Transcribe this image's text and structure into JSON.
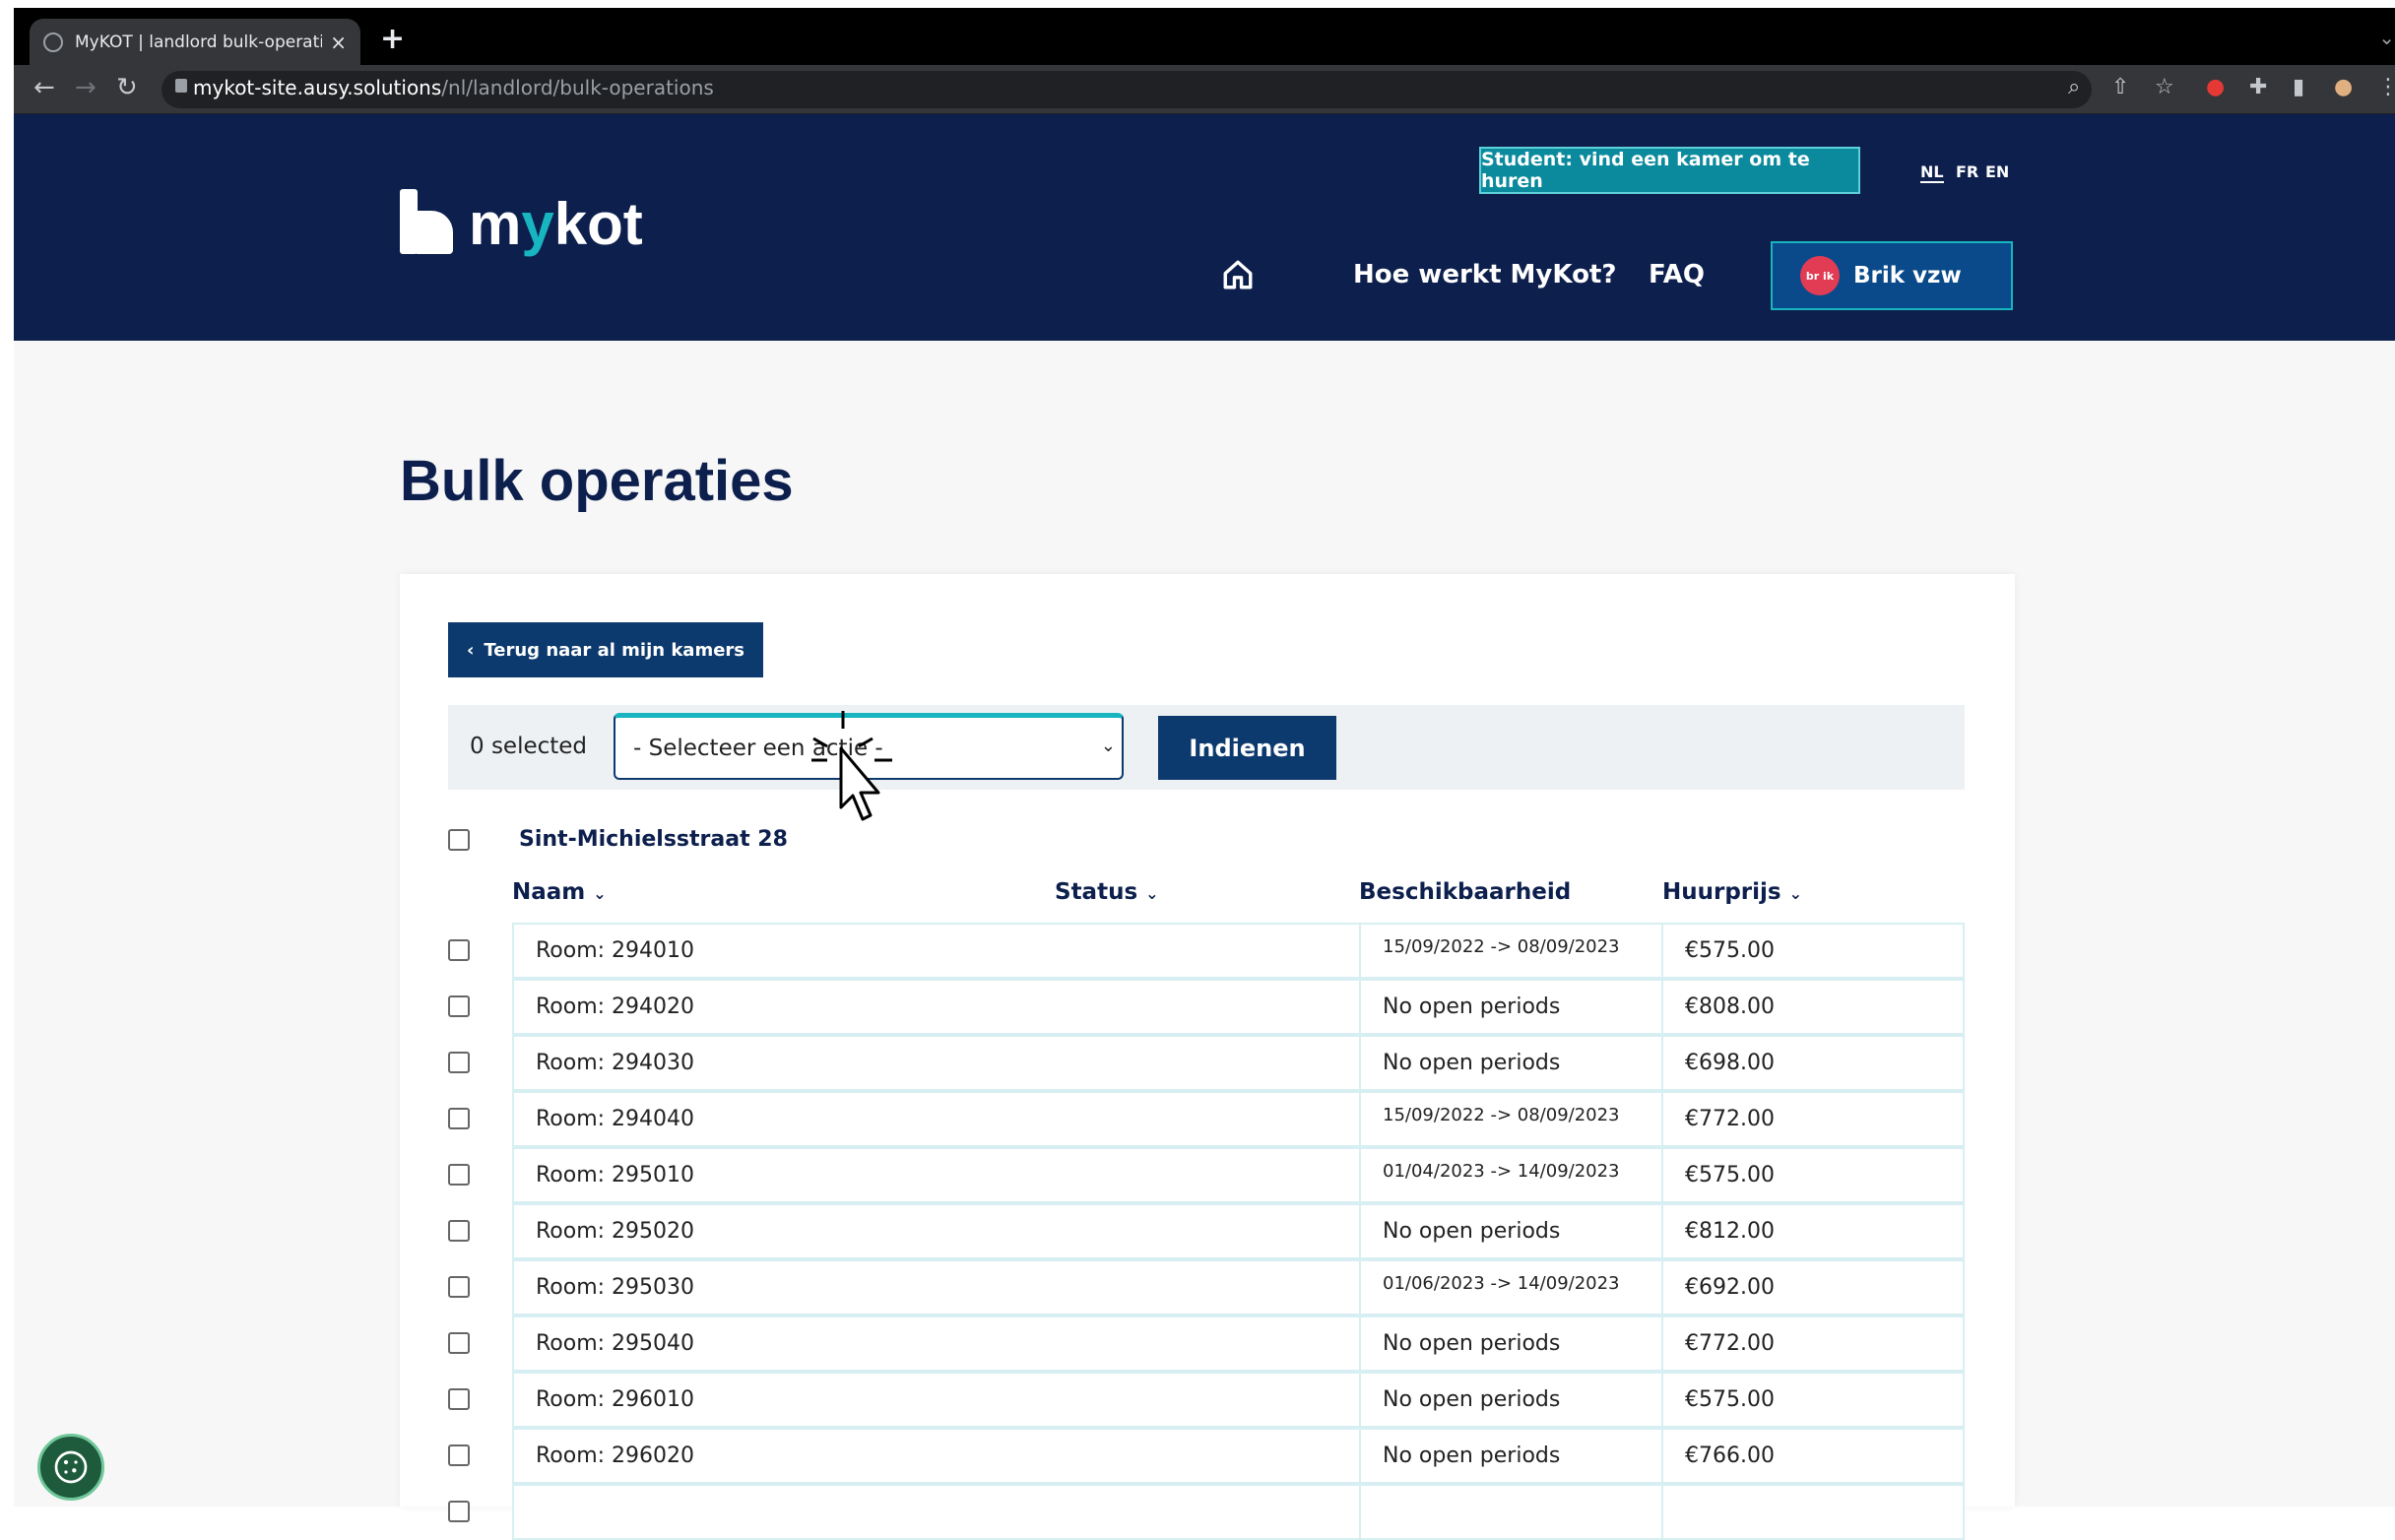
{
  "browser": {
    "tab_title": "MyKOT | landlord bulk-operatio",
    "tab_close": "×",
    "new_tab": "+",
    "url_host": "mykot-site.ausy.solutions",
    "url_path": "/nl/landlord/bulk-operations"
  },
  "header": {
    "logo_text_prefix": "m",
    "logo_text_y": "y",
    "logo_text_suffix": "kot",
    "student_button": "Student: vind een kamer om te huren",
    "languages": [
      "NL",
      "FR",
      "EN"
    ],
    "active_language": "NL",
    "nav": {
      "how_it_works": "Hoe werkt MyKot?",
      "faq": "FAQ"
    },
    "user": {
      "avatar_text": "br ik",
      "name": "Brik vzw"
    }
  },
  "page": {
    "title": "Bulk operaties",
    "back_button": "Terug naar al mijn kamers",
    "selected_count": "0 selected",
    "action_select_value": "- Selecteer een actie -",
    "submit_button": "Indienen",
    "group_title": "Sint-Michielsstraat 28",
    "columns": {
      "name": "Naam",
      "status": "Status",
      "availability": "Beschikbaarheid",
      "price": "Huurprijs"
    },
    "rooms": [
      {
        "name": "Room: 294010",
        "availability": "15/09/2022 -> 08/09/2023",
        "price": "€575.00"
      },
      {
        "name": "Room: 294020",
        "availability": "No open periods",
        "price": "€808.00"
      },
      {
        "name": "Room: 294030",
        "availability": "No open periods",
        "price": "€698.00"
      },
      {
        "name": "Room: 294040",
        "availability": "15/09/2022 -> 08/09/2023",
        "price": "€772.00"
      },
      {
        "name": "Room: 295010",
        "availability": "01/04/2023 -> 14/09/2023",
        "price": "€575.00"
      },
      {
        "name": "Room: 295020",
        "availability": "No open periods",
        "price": "€812.00"
      },
      {
        "name": "Room: 295030",
        "availability": "01/06/2023 -> 14/09/2023",
        "price": "€692.00"
      },
      {
        "name": "Room: 295040",
        "availability": "No open periods",
        "price": "€772.00"
      },
      {
        "name": "Room: 296010",
        "availability": "No open periods",
        "price": "€575.00"
      },
      {
        "name": "Room: 296020",
        "availability": "No open periods",
        "price": "€766.00"
      },
      {
        "name": "",
        "availability": "",
        "price": ""
      }
    ]
  },
  "colors": {
    "header_bg": "#0d1f4d",
    "accent": "#18b4c0",
    "button_bg": "#0d3a6e",
    "row_border": "#d7eff2"
  },
  "icons": {
    "home": "home-icon",
    "cookie": "cookie-icon",
    "chevron": "chevron-down-icon"
  }
}
